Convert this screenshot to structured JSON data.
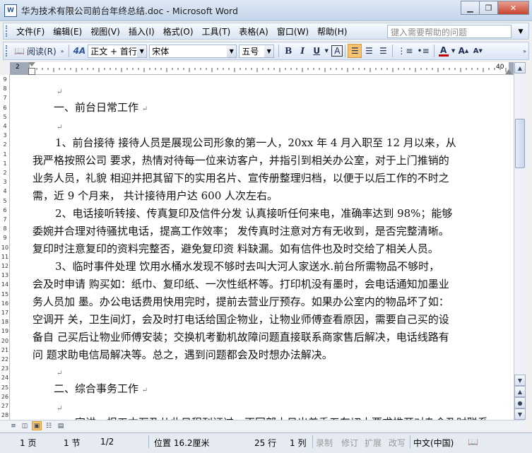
{
  "window": {
    "title": "华为技术有限公司前台年终总结.doc - Microsoft Word",
    "icon_text": "W"
  },
  "menubar": {
    "items": [
      "文件(F)",
      "编辑(E)",
      "视图(V)",
      "插入(I)",
      "格式(O)",
      "工具(T)",
      "表格(A)",
      "窗口(W)",
      "帮助(H)"
    ],
    "help_placeholder": "键入需要帮助的问题"
  },
  "toolbar": {
    "read_label": "阅读(R)",
    "style_icon": "4A",
    "style_value": "正文 + 首行",
    "font_value": "宋体",
    "size_value": "五号",
    "bold": "B",
    "italic": "I",
    "underline": "U",
    "charborder": "A",
    "font_color": "A",
    "grow": "A",
    "shrink": "A"
  },
  "ruler": {
    "left_labels": [
      "2"
    ],
    "right_label": "40"
  },
  "vruler_labels": [
    "9",
    "8",
    "7",
    "6",
    "5",
    "4",
    "3",
    "2",
    "1",
    "1",
    "2",
    "3",
    "4",
    "5",
    "6",
    "7",
    "8",
    "9",
    "10",
    "11",
    "12",
    "13",
    "14",
    "15",
    "16",
    "17",
    "18",
    "19",
    "20",
    "21",
    "22",
    "23",
    "24",
    "25",
    "26",
    "27",
    "28"
  ],
  "document": {
    "mark": "↵",
    "heading1": "一、前台日常工作",
    "para1": [
      "1、前台接待 接待人员是展现公司形象的第一人，20xx 年 4 月入职至 12 月以来，从",
      "我严格按照公司 要求，热情对待每一位来访客户，并指引到相关办公室，对于上门推销的",
      "业务人员，礼貌 相迎并把其留下的实用名片、宣传册整理归档，以便于以后工作的不时之",
      "需，近 9 个月来， 共计接待用户达 600 人次左右。"
    ],
    "para2": [
      "2、电话接听转接、传真复印及信件分发 认真接听任何来电，准确率达到 98%；能够",
      "委婉并合理对待骚扰电话，提高工作效率； 发传真时注意对方有无收到，是否完整清晰。",
      "复印时注意复印的资料完整否，避免复印资 料缺漏。如有信件也及时交给了相关人员。"
    ],
    "para3": [
      "3、临时事件处理 饮用水桶水发现不够时去叫大河人家送水.前台所需物品不够时，",
      "会及时申请 购买如：纸巾、复印纸、一次性纸杯等。打印机没有墨时，会电话通知加墨业",
      "务人员加 墨。办公电话费用快用完时，提前去营业厅预存。如果办公室内的物品坏了如：",
      "空调开 关，卫生间灯，会及时打电话给国企物业，让物业师傅查看原因，需要自己买的设",
      "备自 己买后让物业师傅安装；交换机考勤机故障问题直接联系商家售后解决，电话线路有",
      "问 题求助电信局解决等。总之，遇到问题都会及时想办法解决。"
    ],
    "heading2": "二、综合事务工作",
    "para4": [
      "……宣讲、报工本万及儿此日程刊证过，不同部十日出差手五车切木要求推开对杂会及时联系"
    ]
  },
  "status": {
    "page": "1 页",
    "section": "1 节",
    "pages": "1/2",
    "position": "位置 16.2厘米",
    "line": "25 行",
    "col": "1 列",
    "rec": "录制",
    "trk": "修订",
    "ext": "扩展",
    "ovr": "改写",
    "lang": "中文(中国)"
  },
  "colors": {
    "accent": "#2b579a",
    "toolbar_bg": "#dae5f3",
    "active": "#f7c36e",
    "font_color_bar": "#c00000"
  }
}
